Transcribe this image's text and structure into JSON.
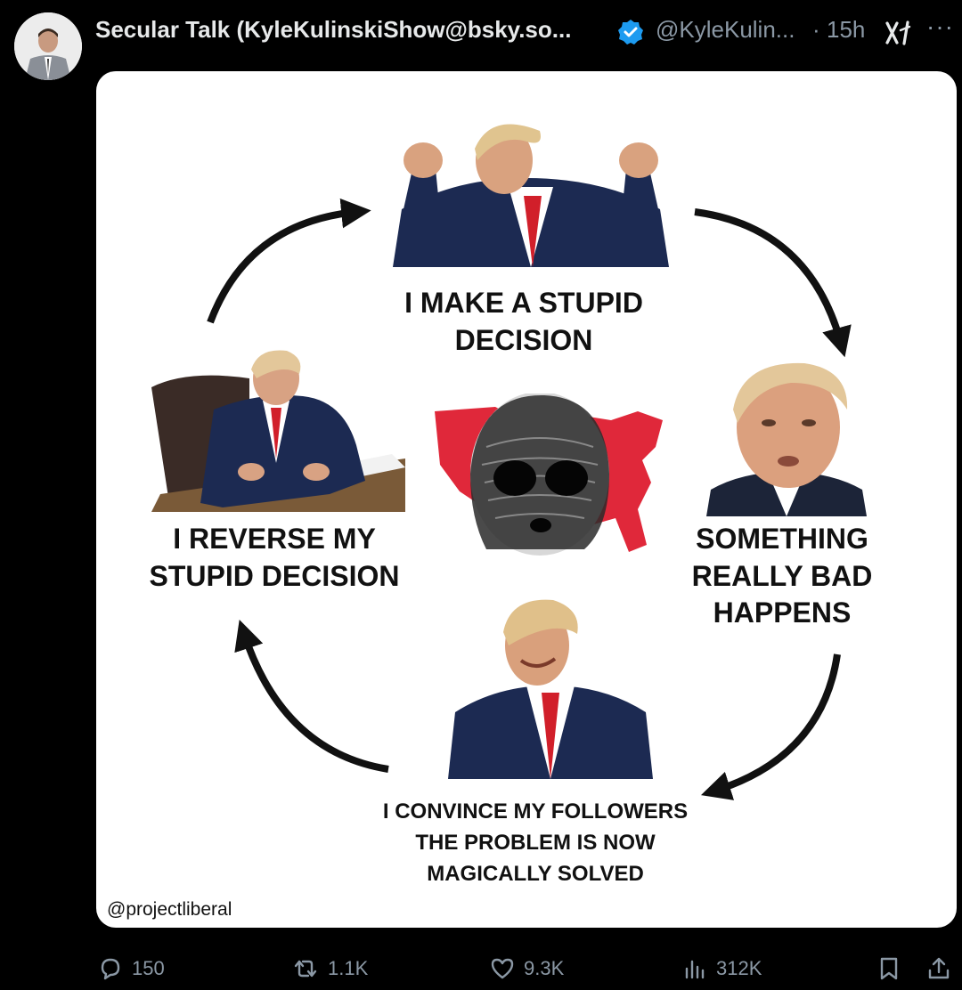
{
  "post": {
    "author_name": "Secular Talk (KyleKulinskiShow@bsky.so...",
    "handle": "@KyleKulin...",
    "separator": "·",
    "time": "15h",
    "more": "···"
  },
  "meme": {
    "caption_top": "I MAKE A STUPID\nDECISION",
    "caption_right": "SOMETHING\nREALLY BAD\nHAPPENS",
    "caption_bottom": "I CONVINCE MY FOLLOWERS\nTHE PROBLEM IS NOW\nMAGICALLY SOLVED",
    "caption_left": "I REVERSE MY\nSTUPID DECISION",
    "credit": "@projectliberal",
    "colors": {
      "map": "#e0283a",
      "suit": "#1c2a52",
      "tie": "#d11f2a"
    }
  },
  "actions": {
    "replies": "150",
    "reposts": "1.1K",
    "likes": "9.3K",
    "views": "312K"
  },
  "icons": [
    "verified-badge-icon",
    "grok-icon",
    "more-icon",
    "reply-icon",
    "repost-icon",
    "like-icon",
    "views-icon",
    "bookmark-icon",
    "share-icon"
  ]
}
